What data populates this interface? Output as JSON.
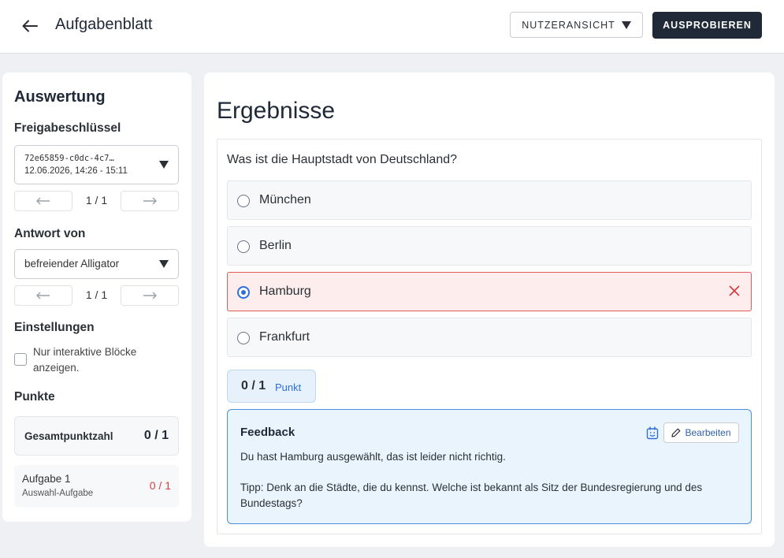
{
  "header": {
    "title": "Aufgabenblatt",
    "view_label": "NUTZERANSICHT",
    "try_label": "AUSPROBIEREN"
  },
  "sidebar": {
    "title": "Auswertung",
    "share_key": {
      "heading": "Freigabeschlüssel",
      "value_line1": "72e65859-c0dc-4c7…",
      "value_line2": "12.06.2026, 14:26 - 15:11",
      "pager": "1 / 1"
    },
    "answer_from": {
      "heading": "Antwort von",
      "value": "befreiender Alligator",
      "pager": "1 / 1"
    },
    "settings": {
      "heading": "Einstellungen",
      "checkbox_label": "Nur interaktive Blöcke anzeigen.",
      "checked": false
    },
    "points": {
      "heading": "Punkte",
      "total_label": "Gesamtpunktzahl",
      "total_value": "0 / 1",
      "tasks": [
        {
          "name": "Aufgabe 1",
          "type": "Auswahl-Aufgabe",
          "score": "0 / 1"
        }
      ]
    }
  },
  "main": {
    "title": "Ergebnisse",
    "question": "Was ist die Hauptstadt von Deutschland?",
    "options": [
      {
        "label": "München",
        "selected": false,
        "wrong": false
      },
      {
        "label": "Berlin",
        "selected": false,
        "wrong": false
      },
      {
        "label": "Hamburg",
        "selected": true,
        "wrong": true
      },
      {
        "label": "Frankfurt",
        "selected": false,
        "wrong": false
      }
    ],
    "points": {
      "value": "0 / 1",
      "unit": "Punkt"
    },
    "feedback": {
      "title": "Feedback",
      "edit_label": "Bearbeiten",
      "text1": "Du hast Hamburg ausgewählt, das ist leider nicht richtig.",
      "text2": "Tipp: Denk an die Städte, die du kennst. Welche ist bekannt als Sitz der Bundesregierung und des Bundestags?"
    }
  },
  "colors": {
    "accent": "#2f6fdb",
    "dark_button": "#1f2937",
    "error": "#d14343",
    "feedback_bg": "#e9f4fd"
  },
  "icons": [
    "arrow-left-icon",
    "caret-down-icon",
    "close-icon",
    "ai-assistant-icon",
    "pencil-icon"
  ]
}
